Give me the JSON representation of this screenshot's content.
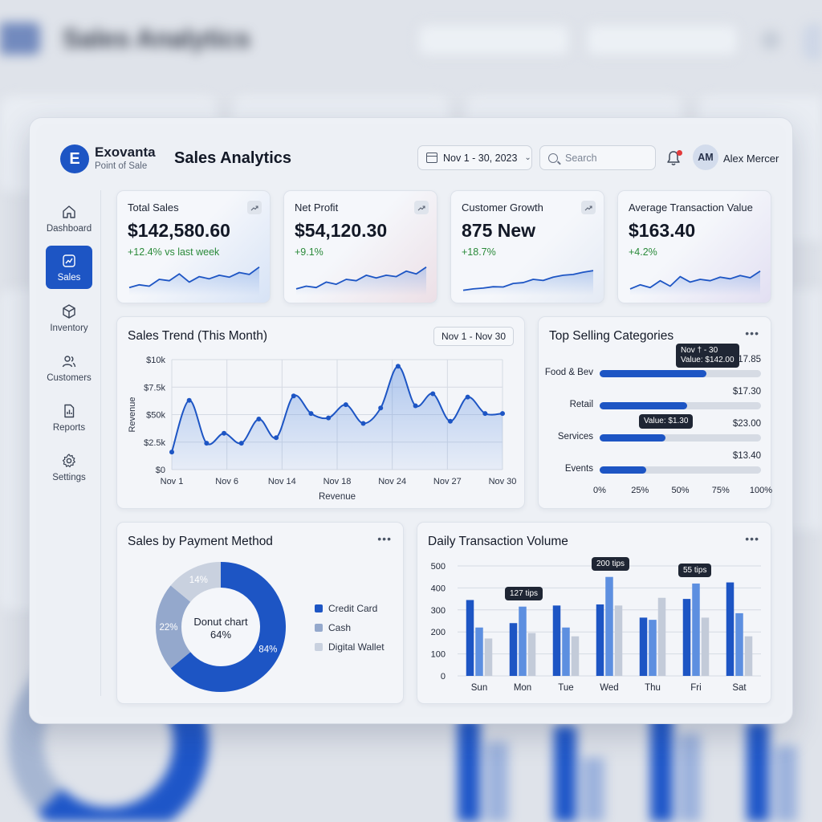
{
  "app": {
    "brand_name": "Exovanta",
    "brand_sub": "Point of Sale",
    "brand_letter": "E",
    "page_title": "Sales Analytics"
  },
  "header": {
    "date_range": "Nov 1 - 30, 2023",
    "search_placeholder": "Search",
    "user_initials": "AM",
    "user_name": "Alex Mercer"
  },
  "sidebar": {
    "items": [
      {
        "label": "Dashboard",
        "icon": "home-icon",
        "active": false
      },
      {
        "label": "Sales",
        "icon": "chart-icon",
        "active": true
      },
      {
        "label": "Inventory",
        "icon": "box-icon",
        "active": false
      },
      {
        "label": "Customers",
        "icon": "users-icon",
        "active": false
      },
      {
        "label": "Reports",
        "icon": "report-icon",
        "active": false
      },
      {
        "label": "Settings",
        "icon": "gear-icon",
        "active": false
      }
    ]
  },
  "kpis": [
    {
      "label": "Total Sales",
      "value": "$142,580.60",
      "delta": "+12.4% vs last week",
      "spark": [
        2,
        3,
        2.5,
        5,
        4.5,
        7,
        4,
        6,
        5.2,
        6.5,
        5.8,
        7.5,
        6.8,
        9.5
      ]
    },
    {
      "label": "Net Profit",
      "value": "$54,120.30",
      "delta": "+9.1%",
      "spark": [
        1.5,
        2.5,
        2,
        4,
        3.2,
        5,
        4.5,
        6.5,
        5.5,
        6.5,
        6,
        8,
        7,
        9.5
      ]
    },
    {
      "label": "Customer Growth",
      "value": "875 New",
      "delta": "+18.7%",
      "spark": [
        1,
        1.5,
        1.8,
        2.3,
        2.2,
        3.5,
        3.8,
        5,
        4.6,
        5.8,
        6.5,
        6.8,
        7.6,
        8.2
      ]
    },
    {
      "label": "Average Transaction Value",
      "value": "$163.40",
      "delta": "+4.2%",
      "spark": [
        1.5,
        3,
        2,
        4.5,
        2.5,
        6,
        4,
        5,
        4.5,
        5.8,
        5.2,
        6.4,
        5.6,
        8
      ]
    }
  ],
  "sales_trend": {
    "title": "Sales Trend (This Month)",
    "range_pill": "Nov 1 - Nov 30"
  },
  "top_categories": {
    "title": "Top Selling Categories",
    "more": "•••"
  },
  "payment": {
    "title": "Sales by Payment Method",
    "center_line1": "Donut chart",
    "center_line2": "64%",
    "more": "•••"
  },
  "daily": {
    "title": "Daily Transaction Volume",
    "more": "•••"
  },
  "colors": {
    "accent": "#1d55c4",
    "mid": "#5d8fe0",
    "light": "#c3cbd9",
    "positive": "#2a8a3a"
  },
  "chart_data": [
    {
      "type": "area",
      "title": "Sales Trend (This Month)",
      "xlabel": "Revenue",
      "ylabel": "Revenue",
      "x_ticks": [
        "Nov 1",
        "Nov 6",
        "Nov 14",
        "Nov 18",
        "Nov 24",
        "Nov 27",
        "Nov 30"
      ],
      "y_ticks": [
        "$0",
        "$2.5k",
        "$50k",
        "$7.5k",
        "$10k"
      ],
      "ylim": [
        0,
        10
      ],
      "grid": true,
      "x": [
        1,
        2,
        3,
        4,
        5,
        6,
        7,
        8,
        9,
        10,
        11,
        12,
        13,
        14,
        15,
        16,
        17,
        18,
        19,
        20,
        21,
        22,
        23,
        24,
        25,
        26
      ],
      "values": [
        1.6,
        6.3,
        2.4,
        3.3,
        2.4,
        4.6,
        2.9,
        6.7,
        5.1,
        4.7,
        5.9,
        4.2,
        5.6,
        9.4,
        5.8,
        6.9,
        4.4,
        6.6,
        5.1,
        5.1,
        5.1,
        5.1,
        5.1,
        5.1,
        5.1,
        5.1
      ],
      "points_shown": 20
    },
    {
      "type": "bar",
      "title": "Top Selling Categories",
      "orientation": "horizontal",
      "categories": [
        "Food & Bev",
        "Retail",
        "Services",
        "Events"
      ],
      "value_labels": [
        "$17.85",
        "$17.30",
        "$23.00",
        "$13.40"
      ],
      "fill_percent": [
        66,
        54,
        41,
        29
      ],
      "x_ticks": [
        "0%",
        "25%",
        "50%",
        "75%",
        "100%"
      ],
      "tooltips": [
        {
          "category": "Food & Bev",
          "lines": [
            "Nov † - 30",
            "Value: $142.00"
          ]
        },
        {
          "category": "Services",
          "lines": [
            "Value: $1.30"
          ]
        }
      ]
    },
    {
      "type": "pie",
      "title": "Sales by Payment Method",
      "donut": true,
      "labels": [
        "Credit Card",
        "Cash",
        "Digital Wallet"
      ],
      "values": [
        64,
        22,
        14
      ],
      "value_labels": [
        "84%",
        "22%",
        "14%"
      ]
    },
    {
      "type": "bar",
      "title": "Daily Transaction Volume",
      "categories": [
        "Sun",
        "Mon",
        "Tue",
        "Wed",
        "Thu",
        "Fri",
        "Sat"
      ],
      "ylim": [
        0,
        500
      ],
      "y_ticks": [
        "0",
        "100",
        "200",
        "300",
        "400",
        "500"
      ],
      "grid": true,
      "series": [
        {
          "values": [
            345,
            240,
            320,
            325,
            265,
            350,
            425
          ]
        },
        {
          "values": [
            220,
            315,
            220,
            450,
            255,
            420,
            285
          ]
        },
        {
          "values": [
            170,
            195,
            180,
            320,
            355,
            265,
            180
          ]
        }
      ],
      "tooltips": [
        {
          "category": "Mon",
          "text": "127 tips"
        },
        {
          "category": "Wed",
          "text": "200 tips"
        },
        {
          "category": "Fri",
          "text": "55 tips"
        }
      ]
    }
  ]
}
